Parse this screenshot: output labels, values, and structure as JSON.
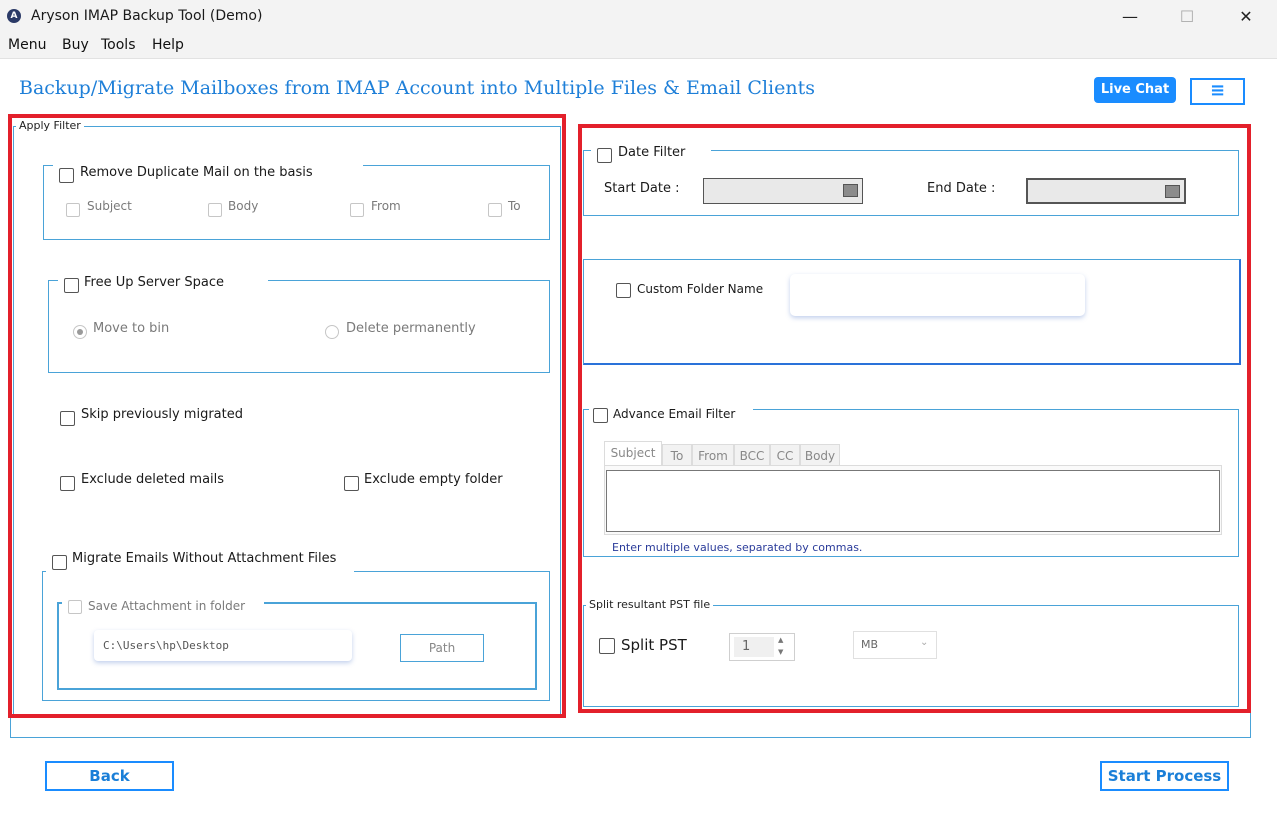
{
  "window": {
    "title": "Aryson IMAP Backup Tool (Demo)",
    "icon": "app-logo-icon",
    "controls": {
      "minimize": "—",
      "maximize": "☐",
      "close": "✕"
    }
  },
  "menu": [
    "Menu",
    "Buy",
    "Tools",
    "Help"
  ],
  "header": {
    "title": "Backup/Migrate Mailboxes from IMAP Account into Multiple Files & Email Clients",
    "live_chat": "Live Chat",
    "hamburger": "≡"
  },
  "left": {
    "legend": "Apply Filter",
    "duplicate": {
      "label": "Remove Duplicate Mail on the basis",
      "options": [
        "Subject",
        "Body",
        "From",
        "To"
      ]
    },
    "free_up": {
      "label": "Free Up Server Space",
      "move_to_bin": "Move to bin",
      "delete_permanently": "Delete permanently"
    },
    "skip_migrated": "Skip previously migrated",
    "exclude_deleted": "Exclude deleted mails",
    "exclude_empty": "Exclude empty folder",
    "without_attachment": {
      "label": "Migrate Emails Without Attachment Files",
      "save_attachment": "Save Attachment in folder",
      "path_value": "C:\\Users\\hp\\Desktop",
      "path_button": "Path"
    }
  },
  "right": {
    "date_filter": {
      "label": "Date Filter",
      "start_label": "Start Date :",
      "end_label": "End Date :"
    },
    "custom_folder": {
      "label": "Custom Folder Name",
      "value": ""
    },
    "advance_filter": {
      "label": "Advance Email Filter",
      "tabs": [
        "Subject",
        "To",
        "From",
        "BCC",
        "CC",
        "Body"
      ],
      "hint": "Enter multiple values, separated by commas."
    },
    "split": {
      "legend": "Split resultant PST file",
      "label": "Split PST",
      "value": "1",
      "unit": "MB"
    }
  },
  "footer": {
    "back": "Back",
    "start": "Start Process"
  },
  "colors": {
    "accent": "#1a8cff",
    "heading": "#1e7fd8",
    "highlight": "#e3202b",
    "frame": "#4aa3d8"
  }
}
